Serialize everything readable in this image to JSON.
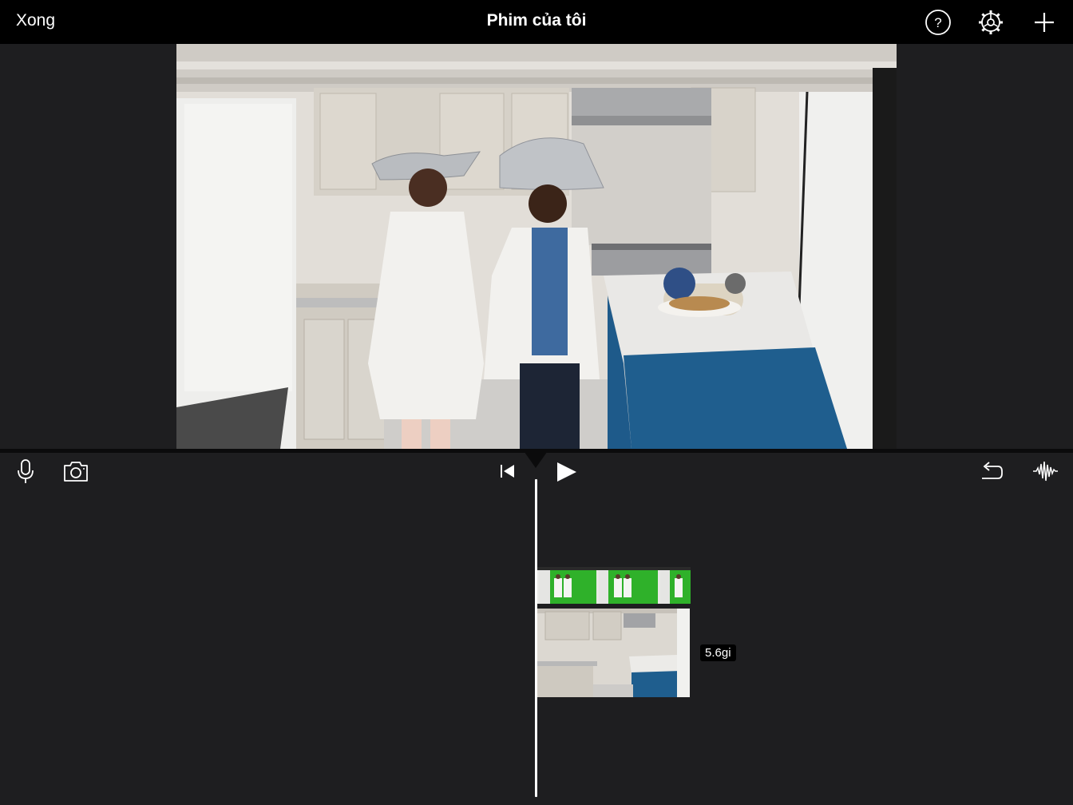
{
  "topbar": {
    "done_label": "Xong",
    "title": "Phim của tôi",
    "icons": [
      "help-icon",
      "gear-icon",
      "plus-icon"
    ]
  },
  "toolbar": {
    "left_icons": [
      "microphone-icon",
      "camera-icon"
    ],
    "center_icons": [
      "skip-to-start-icon",
      "play-icon"
    ],
    "right_icons": [
      "undo-icon",
      "audio-waveform-icon"
    ]
  },
  "timeline": {
    "clip_duration": "5.6gi"
  },
  "colors": {
    "topbar_bg": "#000000",
    "background": "#1e1e20",
    "green_screen": "#2fb12a",
    "island_blue": "#1f5e8e"
  }
}
